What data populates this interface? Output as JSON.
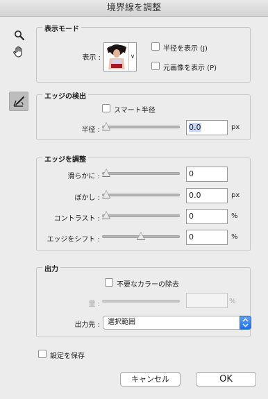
{
  "window": {
    "title": "境界線を調整"
  },
  "tools": [
    "zoom-tool",
    "hand-tool",
    "refine-radius-tool"
  ],
  "view_mode": {
    "title": "表示モード",
    "view_label": "表示 :",
    "show_radius": "半径を表示 (J)",
    "show_original": "元画像を表示 (P)"
  },
  "edge_detection": {
    "title": "エッジの検出",
    "smart_radius": "スマート半径",
    "radius_label": "半径 :",
    "radius_value": "0.0",
    "radius_unit": "px",
    "radius_slider": 0
  },
  "adjust_edge": {
    "title": "エッジを調整",
    "rows": [
      {
        "label": "滑らかに :",
        "value": "0",
        "unit": "",
        "slider": 0
      },
      {
        "label": "ぼかし :",
        "value": "0.0",
        "unit": "px",
        "slider": 0
      },
      {
        "label": "コントラスト :",
        "value": "0",
        "unit": "%",
        "slider": 0
      },
      {
        "label": "エッジをシフト :",
        "value": "0",
        "unit": "%",
        "slider": 0.5
      }
    ]
  },
  "output": {
    "title": "出力",
    "decontaminate": "不要なカラーの除去",
    "amount_label": "量 :",
    "amount_value": "",
    "amount_unit": "%",
    "output_to_label": "出力先 :",
    "output_to_value": "選択範囲"
  },
  "remember": "設定を保存",
  "buttons": {
    "cancel": "キャンセル",
    "ok": "OK"
  }
}
